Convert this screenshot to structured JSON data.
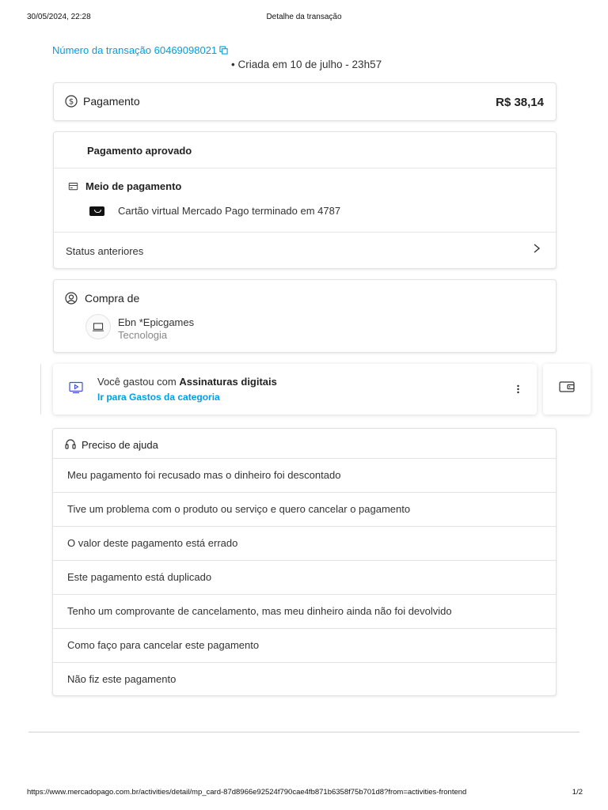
{
  "print_header": {
    "date": "30/05/2024, 22:28",
    "title": "Detalhe da transação"
  },
  "transaction": {
    "link": "Número da transação 60469098021",
    "created": "• Criada em 10 de julho - 23h57"
  },
  "payment": {
    "icon": "dollar-circle-icon",
    "label": "Pagamento",
    "amount": "R$ 38,14"
  },
  "status": {
    "approved": "Pagamento aprovado",
    "method_label": "Meio de pagamento",
    "card_description": "Cartão virtual Mercado Pago terminado em 4787",
    "previous_status": "Status anteriores"
  },
  "purchase": {
    "title": "Compra de",
    "merchant": "Ebn *Epicgames",
    "category": "Tecnologia"
  },
  "spending": {
    "prefix": "Você gastou com ",
    "category": "Assinaturas digitais",
    "link": "Ir para Gastos da categoria"
  },
  "help": {
    "title": "Preciso de ajuda",
    "items": [
      "Meu pagamento foi recusado mas o dinheiro foi descontado",
      "Tive um problema com o produto ou serviço e quero cancelar o pagamento",
      "O valor deste pagamento está errado",
      "Este pagamento está duplicado",
      "Tenho um comprovante de cancelamento, mas meu dinheiro ainda não foi devolvido",
      "Como faço para cancelar este pagamento",
      "Não fiz este pagamento"
    ]
  },
  "print_footer": {
    "url": "https://www.mercadopago.com.br/activities/detail/mp_card-87d8966e92524f790cae4fb871b6358f75b701d8?from=activities-frontend",
    "pages": "1/2"
  },
  "colors": {
    "link": "#009ee3",
    "text": "#222222",
    "border": "#e2e2e2"
  }
}
